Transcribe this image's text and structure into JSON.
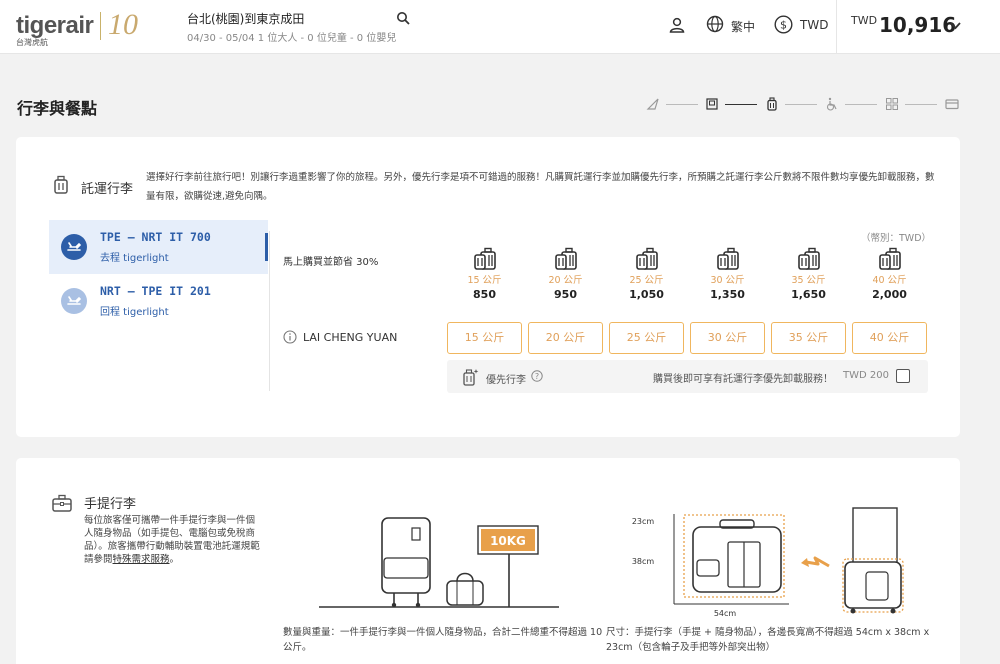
{
  "header": {
    "logo_text": "tigerair",
    "logo_sub": "台灣虎航",
    "anniversary_mark": "10",
    "route_title": "台北(桃園)到東京成田",
    "route_sub": "04/30 - 05/04  1 位大人 - 0 位兒童 - 0 位嬰兒",
    "language": "繁中",
    "currency": "TWD",
    "total_currency": "TWD",
    "total_amount": "10,916"
  },
  "page": {
    "title": "行李與餐點",
    "steps": [
      "plane-icon",
      "seat-icon",
      "luggage-icon",
      "wheelchair-icon",
      "grid-icon",
      "card-icon"
    ],
    "active_step": 2
  },
  "checked": {
    "title": "託運行李",
    "intro": "選擇好行李前往旅行吧！別讓行李過重影響了你的旅程。另外，優先行李是項不可錯過的服務！凡購買託運行李並加購優先行李，所預購之託運行李公斤數將不限件數均享優先卸載服務，數量有限，欲購從速,避免向隅。",
    "flights": [
      {
        "code": "TPE – NRT IT 700",
        "sub": "去程 tigerlight"
      },
      {
        "code": "NRT – TPE IT 201",
        "sub": "回程 tigerlight"
      }
    ],
    "currency_note": "（幣別：TWD）",
    "promo": "馬上購買並節省 30%",
    "options": [
      {
        "kg": "15 公斤",
        "price": "850",
        "button": "15 公斤"
      },
      {
        "kg": "20 公斤",
        "price": "950",
        "button": "20 公斤"
      },
      {
        "kg": "25 公斤",
        "price": "1,050",
        "button": "25 公斤"
      },
      {
        "kg": "30 公斤",
        "price": "1,350",
        "button": "30 公斤"
      },
      {
        "kg": "35 公斤",
        "price": "1,650",
        "button": "35 公斤"
      },
      {
        "kg": "40 公斤",
        "price": "2,000",
        "button": "40 公斤"
      }
    ],
    "passenger": "LAI CHENG YUAN",
    "priority_label": "優先行李",
    "priority_note": "購買後即可享有託運行李優先卸載服務！",
    "priority_price": "TWD 200",
    "priority_checked": false
  },
  "carry": {
    "title": "手提行李",
    "desc_part1": "每位旅客僅可攜帶一件手提行李與一件個人隨身物品（如手提包、電腦包或免稅商品）。旅客攜帶行動輔助裝置電池託運規範請參閱",
    "desc_link": "特殊需求服務",
    "desc_part2": "。",
    "sign_text": "10KG",
    "dim_height": "23cm",
    "dim_depth": "38cm",
    "dim_width": "54cm",
    "caption1": "數量與重量：一件手提行李與一件個人隨身物品，合計二件總重不得超過 10 公斤。",
    "caption2": "尺寸：手提行李（手提 + 隨身物品），各邊長寬高不得超過 54cm x 38cm x 23cm（包含輪子及手把等外部突出物）"
  },
  "colors": {
    "brand_blue": "#2d5ea8",
    "accent_orange": "#e0a05a",
    "sign_orange": "#e8a04a"
  }
}
